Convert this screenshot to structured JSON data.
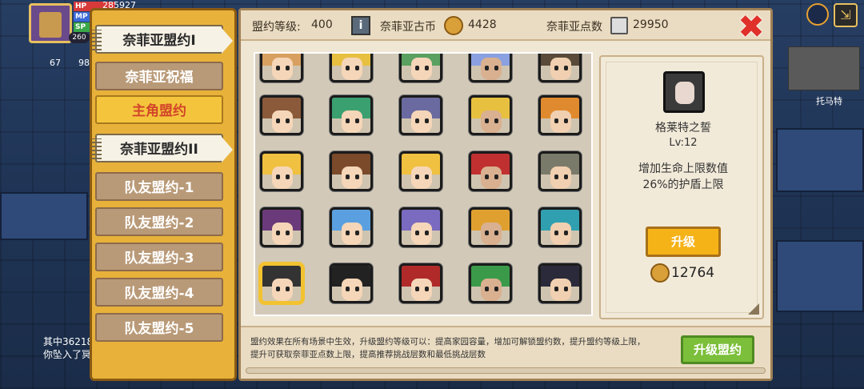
{
  "hud": {
    "hp_label": "HP",
    "mp_label": "MP",
    "sp_label": "SP",
    "hp_value": "285927",
    "level_badge": "260",
    "stat_left": "67",
    "stat_right": "98",
    "npc_name": "托马特",
    "chat_line1": "其中36218",
    "chat_line2": "你坠入了冥"
  },
  "tabs": [
    {
      "label": "奈菲亚盟约I"
    },
    {
      "label": "奈菲亚祝福"
    },
    {
      "label": "主角盟约"
    },
    {
      "label": "奈菲亚盟约II"
    },
    {
      "label": "队友盟约-1"
    },
    {
      "label": "队友盟约-2"
    },
    {
      "label": "队友盟约-3"
    },
    {
      "label": "队友盟约-4"
    },
    {
      "label": "队友盟约-5"
    }
  ],
  "topbar": {
    "level_label": "盟约等级:",
    "level_value": "400",
    "coin_label": "奈菲亚古币",
    "coin_value": "4428",
    "points_label": "奈菲亚点数",
    "points_value": "29950"
  },
  "detail": {
    "name": "格莱特之誓",
    "level": "Lv:12",
    "desc_line1": "增加生命上限数值",
    "desc_line2": "26%的护盾上限",
    "upgrade_label": "升级",
    "cost": "12764"
  },
  "footer": {
    "text_line1": "盟约效果在所有场景中生效，升级盟约等级可以：提高家园容量，增加可解锁盟约数，提升盟约等级上限，",
    "text_line2": "提升可获取奈菲亚点数上限，提高推荐挑战层数和最低挑战层数",
    "upgrade_label": "升级盟约"
  },
  "icons": {
    "close": "close-icon",
    "info": "info-icon",
    "coin": "coin-icon",
    "points": "points-card-icon",
    "settings": "globe-icon",
    "exit": "exit-icon"
  }
}
